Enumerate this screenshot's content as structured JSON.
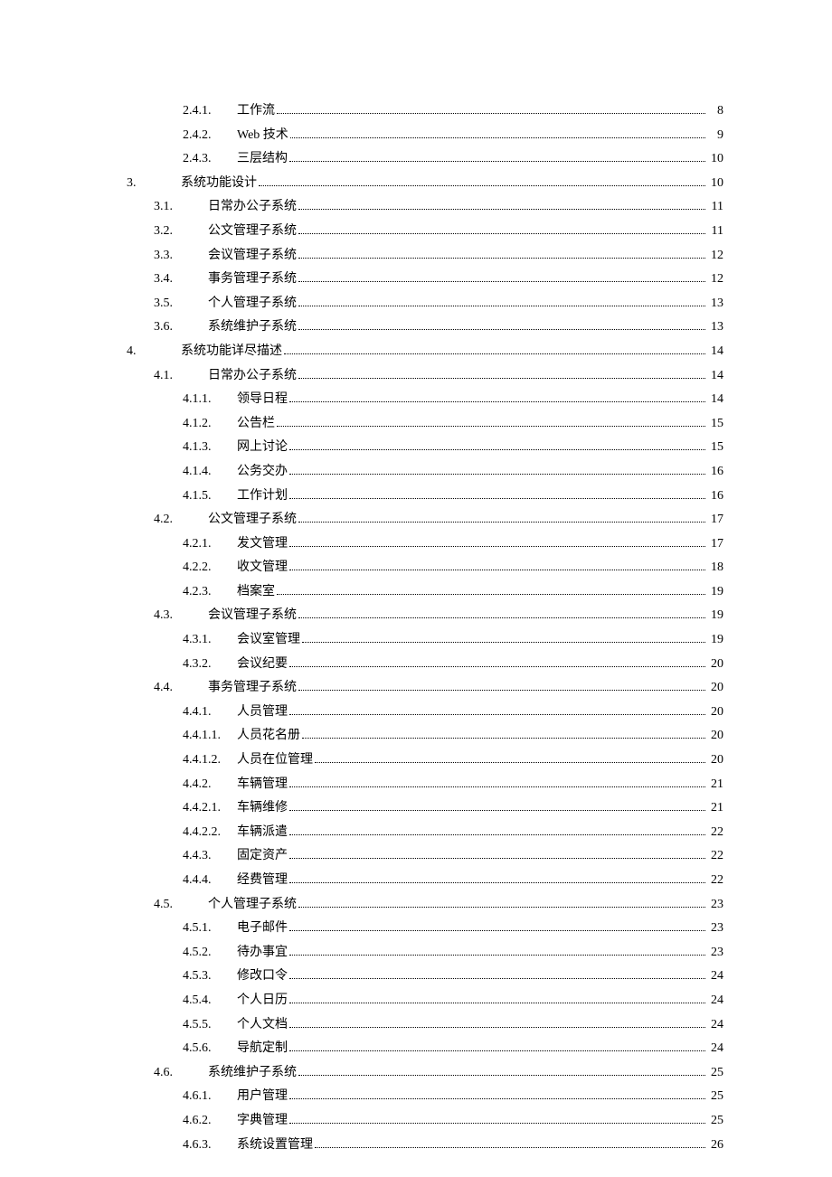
{
  "toc": [
    {
      "level": 3,
      "num": "2.4.1.",
      "title": "工作流",
      "page": "8"
    },
    {
      "level": 3,
      "num": "2.4.2.",
      "title": "Web 技术",
      "page": "9"
    },
    {
      "level": 3,
      "num": "2.4.3.",
      "title": "三层结构",
      "page": "10"
    },
    {
      "level": 1,
      "num": "3.",
      "title": "系统功能设计",
      "page": "10"
    },
    {
      "level": 2,
      "num": "3.1.",
      "title": "日常办公子系统",
      "page": "11"
    },
    {
      "level": 2,
      "num": "3.2.",
      "title": "公文管理子系统",
      "page": "11"
    },
    {
      "level": 2,
      "num": "3.3.",
      "title": "会议管理子系统",
      "page": "12"
    },
    {
      "level": 2,
      "num": "3.4.",
      "title": "事务管理子系统",
      "page": "12"
    },
    {
      "level": 2,
      "num": "3.5.",
      "title": "个人管理子系统",
      "page": "13"
    },
    {
      "level": 2,
      "num": "3.6.",
      "title": "系统维护子系统",
      "page": "13"
    },
    {
      "level": 1,
      "num": "4.",
      "title": "系统功能详尽描述",
      "page": "14"
    },
    {
      "level": 2,
      "num": "4.1.",
      "title": "日常办公子系统",
      "page": "14"
    },
    {
      "level": 3,
      "num": "4.1.1.",
      "title": "领导日程",
      "page": "14"
    },
    {
      "level": 3,
      "num": "4.1.2.",
      "title": "公告栏",
      "page": "15"
    },
    {
      "level": 3,
      "num": "4.1.3.",
      "title": "网上讨论",
      "page": "15"
    },
    {
      "level": 3,
      "num": "4.1.4.",
      "title": "公务交办",
      "page": "16"
    },
    {
      "level": 3,
      "num": "4.1.5.",
      "title": "工作计划",
      "page": "16"
    },
    {
      "level": 2,
      "num": "4.2.",
      "title": "公文管理子系统",
      "page": "17"
    },
    {
      "level": 3,
      "num": "4.2.1.",
      "title": "发文管理",
      "page": "17"
    },
    {
      "level": 3,
      "num": "4.2.2.",
      "title": "收文管理",
      "page": "18"
    },
    {
      "level": 3,
      "num": "4.2.3.",
      "title": "档案室",
      "page": "19"
    },
    {
      "level": 2,
      "num": "4.3.",
      "title": "会议管理子系统",
      "page": "19"
    },
    {
      "level": 3,
      "num": "4.3.1.",
      "title": "会议室管理",
      "page": "19"
    },
    {
      "level": 3,
      "num": "4.3.2.",
      "title": "会议纪要",
      "page": "20"
    },
    {
      "level": 2,
      "num": "4.4.",
      "title": "事务管理子系统",
      "page": "20"
    },
    {
      "level": 3,
      "num": "4.4.1.",
      "title": "人员管理",
      "page": "20"
    },
    {
      "level": 4,
      "num": "4.4.1.1.",
      "title": "人员花名册",
      "page": "20"
    },
    {
      "level": 4,
      "num": "4.4.1.2.",
      "title": "人员在位管理",
      "page": "20"
    },
    {
      "level": 3,
      "num": "4.4.2.",
      "title": "车辆管理",
      "page": "21"
    },
    {
      "level": 4,
      "num": "4.4.2.1.",
      "title": "车辆维修",
      "page": "21"
    },
    {
      "level": 4,
      "num": "4.4.2.2.",
      "title": "车辆派遣",
      "page": "22"
    },
    {
      "level": 3,
      "num": "4.4.3.",
      "title": "固定资产",
      "page": "22"
    },
    {
      "level": 3,
      "num": "4.4.4.",
      "title": "经费管理",
      "page": "22"
    },
    {
      "level": 2,
      "num": "4.5.",
      "title": "个人管理子系统",
      "page": "23"
    },
    {
      "level": 3,
      "num": "4.5.1.",
      "title": "电子邮件",
      "page": "23"
    },
    {
      "level": 3,
      "num": "4.5.2.",
      "title": "待办事宜",
      "page": "23"
    },
    {
      "level": 3,
      "num": "4.5.3.",
      "title": "修改口令",
      "page": "24"
    },
    {
      "level": 3,
      "num": "4.5.4.",
      "title": "个人日历",
      "page": "24"
    },
    {
      "level": 3,
      "num": "4.5.5.",
      "title": "个人文档",
      "page": "24"
    },
    {
      "level": 3,
      "num": "4.5.6.",
      "title": "导航定制",
      "page": "24"
    },
    {
      "level": 2,
      "num": "4.6.",
      "title": "系统维护子系统",
      "page": "25"
    },
    {
      "level": 3,
      "num": "4.6.1.",
      "title": "用户管理",
      "page": "25"
    },
    {
      "level": 3,
      "num": "4.6.2.",
      "title": "字典管理",
      "page": "25"
    },
    {
      "level": 3,
      "num": "4.6.3.",
      "title": "系统设置管理",
      "page": "26"
    }
  ]
}
